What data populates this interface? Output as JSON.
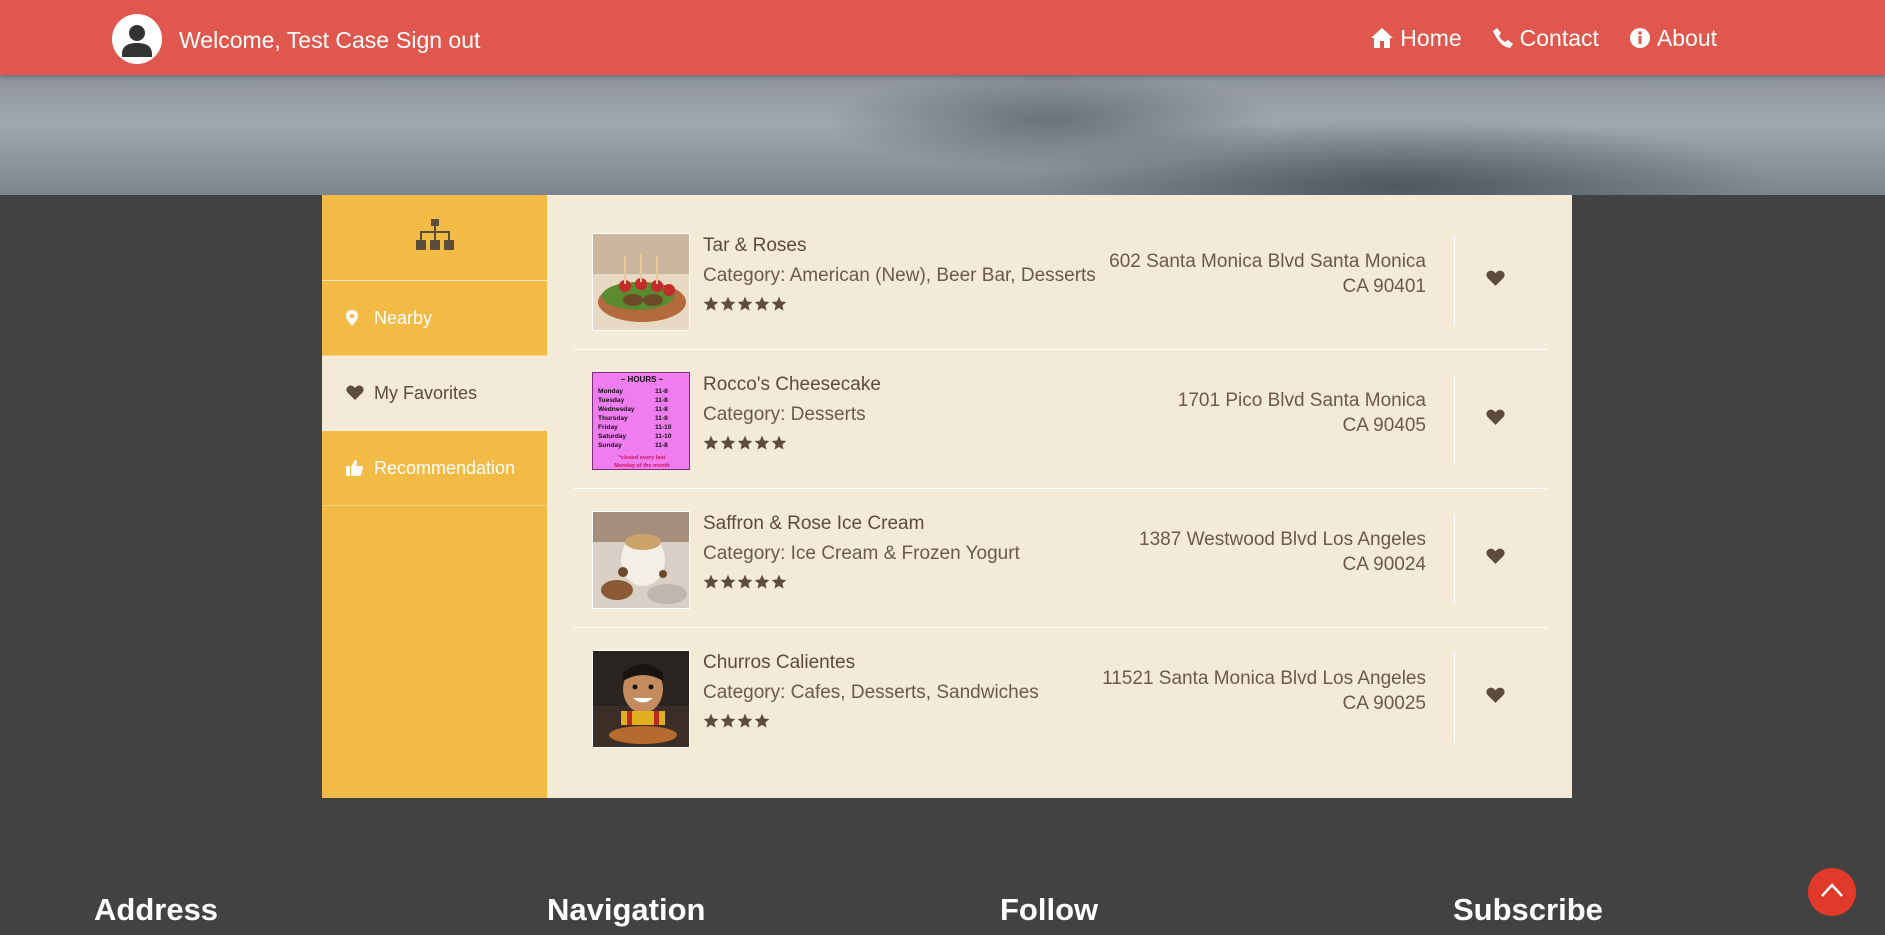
{
  "header": {
    "avatar_icon": "user-icon",
    "welcome": "Welcome, Test Case",
    "signout": "Sign out",
    "nav": [
      {
        "icon": "home-icon",
        "label": "Home"
      },
      {
        "icon": "phone-icon",
        "label": "Contact"
      },
      {
        "icon": "info-icon",
        "label": "About"
      }
    ]
  },
  "sidebar": {
    "top_icon": "sitemap-icon",
    "items": [
      {
        "icon": "map-marker-icon",
        "label": "Nearby",
        "active": false
      },
      {
        "icon": "heart-icon",
        "label": "My Favorites",
        "active": true
      },
      {
        "icon": "thumbs-up-icon",
        "label": "Recommendation",
        "active": false
      }
    ]
  },
  "favorites": [
    {
      "name": "Tar & Roses",
      "category": "Category: American (New), Beer Bar, Desserts",
      "rating": 5,
      "address_line1": "602 Santa Monica Blvd Santa Monica",
      "address_line2": "CA 90401"
    },
    {
      "name": "Rocco's Cheesecake",
      "category": "Category: Desserts",
      "rating": 5,
      "address_line1": "1701 Pico Blvd Santa Monica",
      "address_line2": "CA 90405",
      "thumb_text": {
        "title": "~ HOURS ~",
        "rows": [
          [
            "Monday",
            "11-8"
          ],
          [
            "Tuesday",
            "11-8"
          ],
          [
            "Wednesday",
            "11-8"
          ],
          [
            "Thursday",
            "11-8"
          ],
          [
            "Friday",
            "11-10"
          ],
          [
            "Saturday",
            "11-10"
          ],
          [
            "Sunday",
            "11-8"
          ]
        ],
        "note1": "*closed every last",
        "note2": "Monday of the month"
      }
    },
    {
      "name": "Saffron & Rose Ice Cream",
      "category": "Category: Ice Cream & Frozen Yogurt",
      "rating": 5,
      "address_line1": "1387 Westwood Blvd Los Angeles",
      "address_line2": "CA 90024"
    },
    {
      "name": "Churros Calientes",
      "category": "Category: Cafes, Desserts, Sandwiches",
      "rating": 4,
      "address_line1": "11521 Santa Monica Blvd Los Angeles",
      "address_line2": "CA 90025"
    }
  ],
  "footer": {
    "headings": [
      "Address",
      "Navigation",
      "Follow",
      "Subscribe"
    ],
    "back_to_top_icon": "chevron-up-icon"
  },
  "colors": {
    "header": "#e0584d",
    "sidebar": "#f2bb46",
    "content": "#f3ead8",
    "text": "#5d4b3c",
    "page_bg": "#424242",
    "back_to_top": "#e23a2a"
  }
}
